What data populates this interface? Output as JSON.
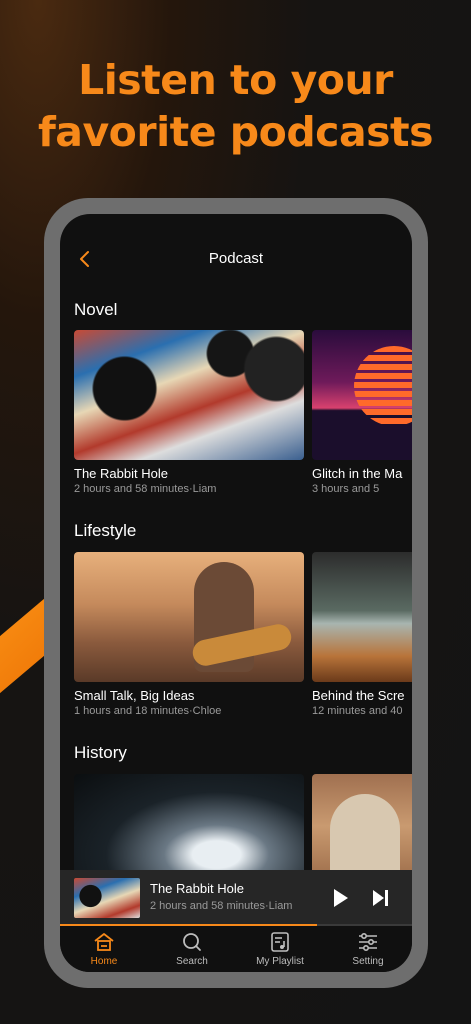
{
  "headline": {
    "line1": "Listen to your",
    "line2": "favorite podcasts"
  },
  "nav": {
    "title": "Podcast",
    "back_icon": "chevron-left-icon"
  },
  "sections": [
    {
      "title": "Novel",
      "cards": [
        {
          "title": "The Rabbit Hole",
          "meta": "2 hours and 58 minutes·Liam",
          "art": "vinyl-records-collage"
        },
        {
          "title": "Glitch in the Ma",
          "meta": "3 hours and 5",
          "art": "synthwave-sunset"
        }
      ]
    },
    {
      "title": "Lifestyle",
      "cards": [
        {
          "title": "Small Talk, Big Ideas",
          "meta": "1 hours and 18 minutes·Chloe",
          "art": "beach-guitar"
        },
        {
          "title": "Behind the Scre",
          "meta": "12 minutes and 40",
          "art": "cafe-window"
        }
      ]
    },
    {
      "title": "History",
      "cards": [
        {
          "title": "",
          "meta": "",
          "art": "ice-cave"
        },
        {
          "title": "",
          "meta": "",
          "art": "palace-arches"
        }
      ]
    }
  ],
  "player": {
    "title": "The Rabbit Hole",
    "meta": "2 hours and 58 minutes·Liam",
    "progress": 0.73,
    "play_icon": "play-icon",
    "next_icon": "skip-next-icon"
  },
  "tabs": [
    {
      "label": "Home",
      "icon": "home-icon",
      "active": true
    },
    {
      "label": "Search",
      "icon": "search-icon",
      "active": false
    },
    {
      "label": "My Playlist",
      "icon": "playlist-icon",
      "active": false
    },
    {
      "label": "Setting",
      "icon": "sliders-icon",
      "active": false
    }
  ],
  "colors": {
    "accent": "#f7891a",
    "background": "#101010",
    "muted_text": "#9a9a9a"
  }
}
